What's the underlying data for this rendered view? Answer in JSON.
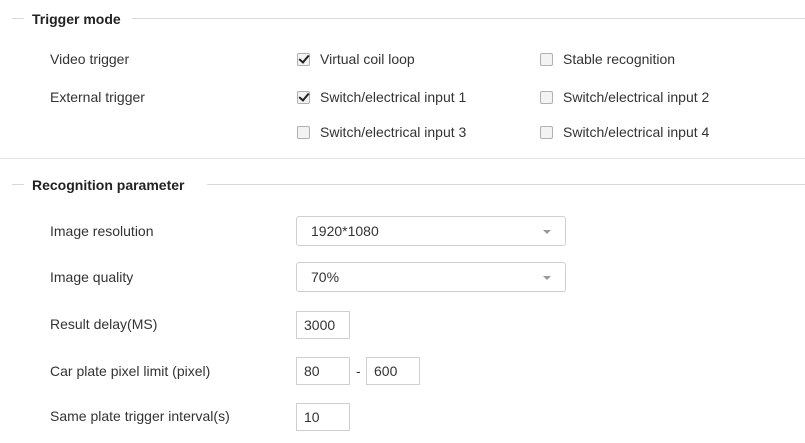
{
  "trigger_mode": {
    "title": "Trigger mode",
    "video_trigger": {
      "label": "Video trigger",
      "options": [
        {
          "label": "Virtual coil loop",
          "checked": true
        },
        {
          "label": "Stable recognition",
          "checked": false
        }
      ]
    },
    "external_trigger": {
      "label": "External trigger",
      "options": [
        {
          "label": "Switch/electrical input 1",
          "checked": true
        },
        {
          "label": "Switch/electrical input 2",
          "checked": false
        },
        {
          "label": "Switch/electrical input 3",
          "checked": false
        },
        {
          "label": "Switch/electrical input 4",
          "checked": false
        }
      ]
    }
  },
  "recognition": {
    "title": "Recognition parameter",
    "image_resolution": {
      "label": "Image resolution",
      "value": "1920*1080"
    },
    "image_quality": {
      "label": "Image quality",
      "value": "70%"
    },
    "result_delay": {
      "label": "Result delay(MS)",
      "value": "3000"
    },
    "pixel_limit": {
      "label": "Car plate pixel limit (pixel)",
      "min": "80",
      "separator": "-",
      "max": "600"
    },
    "same_plate_interval": {
      "label": "Same plate trigger interval(s)",
      "value": "10"
    }
  }
}
